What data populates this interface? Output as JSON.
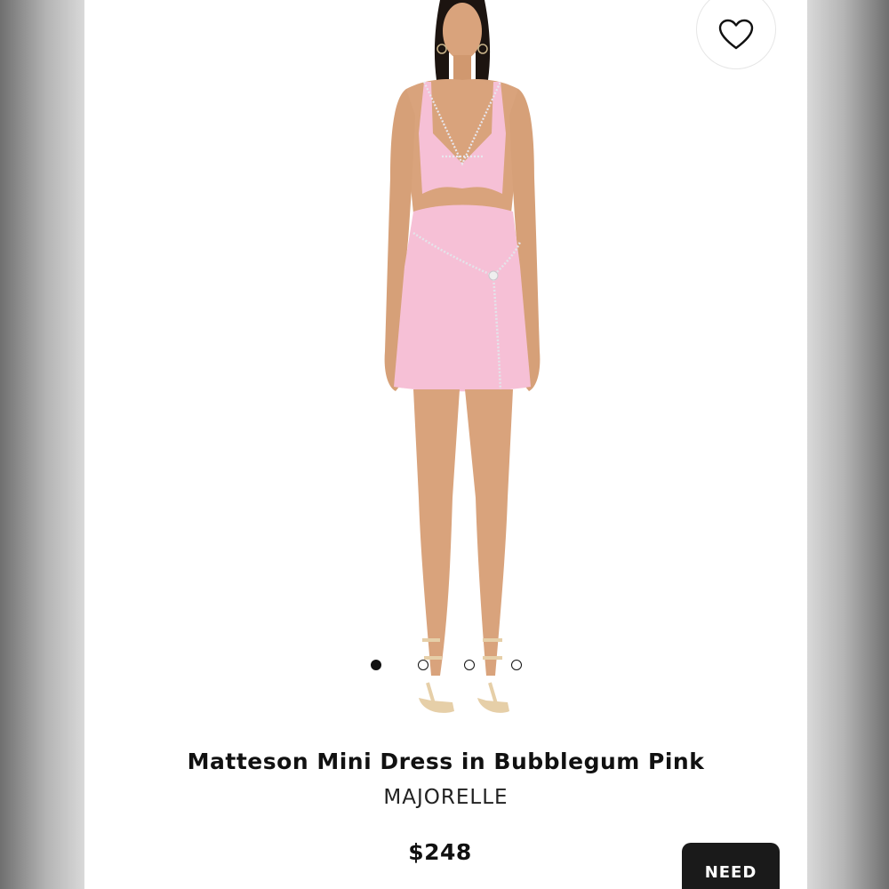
{
  "product": {
    "title": "Matteson Mini Dress in Bubblegum Pink",
    "brand": "MAJORELLE",
    "price": "$248"
  },
  "carousel": {
    "total": 4,
    "active_index": 0
  },
  "actions": {
    "favorite_icon": "heart-outline-icon",
    "need_label": "NEED"
  },
  "colors": {
    "dress": "#f6c0d6",
    "skin": "#d9a37c",
    "hair": "#1c1410",
    "accent_dark": "#1a1a1a"
  }
}
